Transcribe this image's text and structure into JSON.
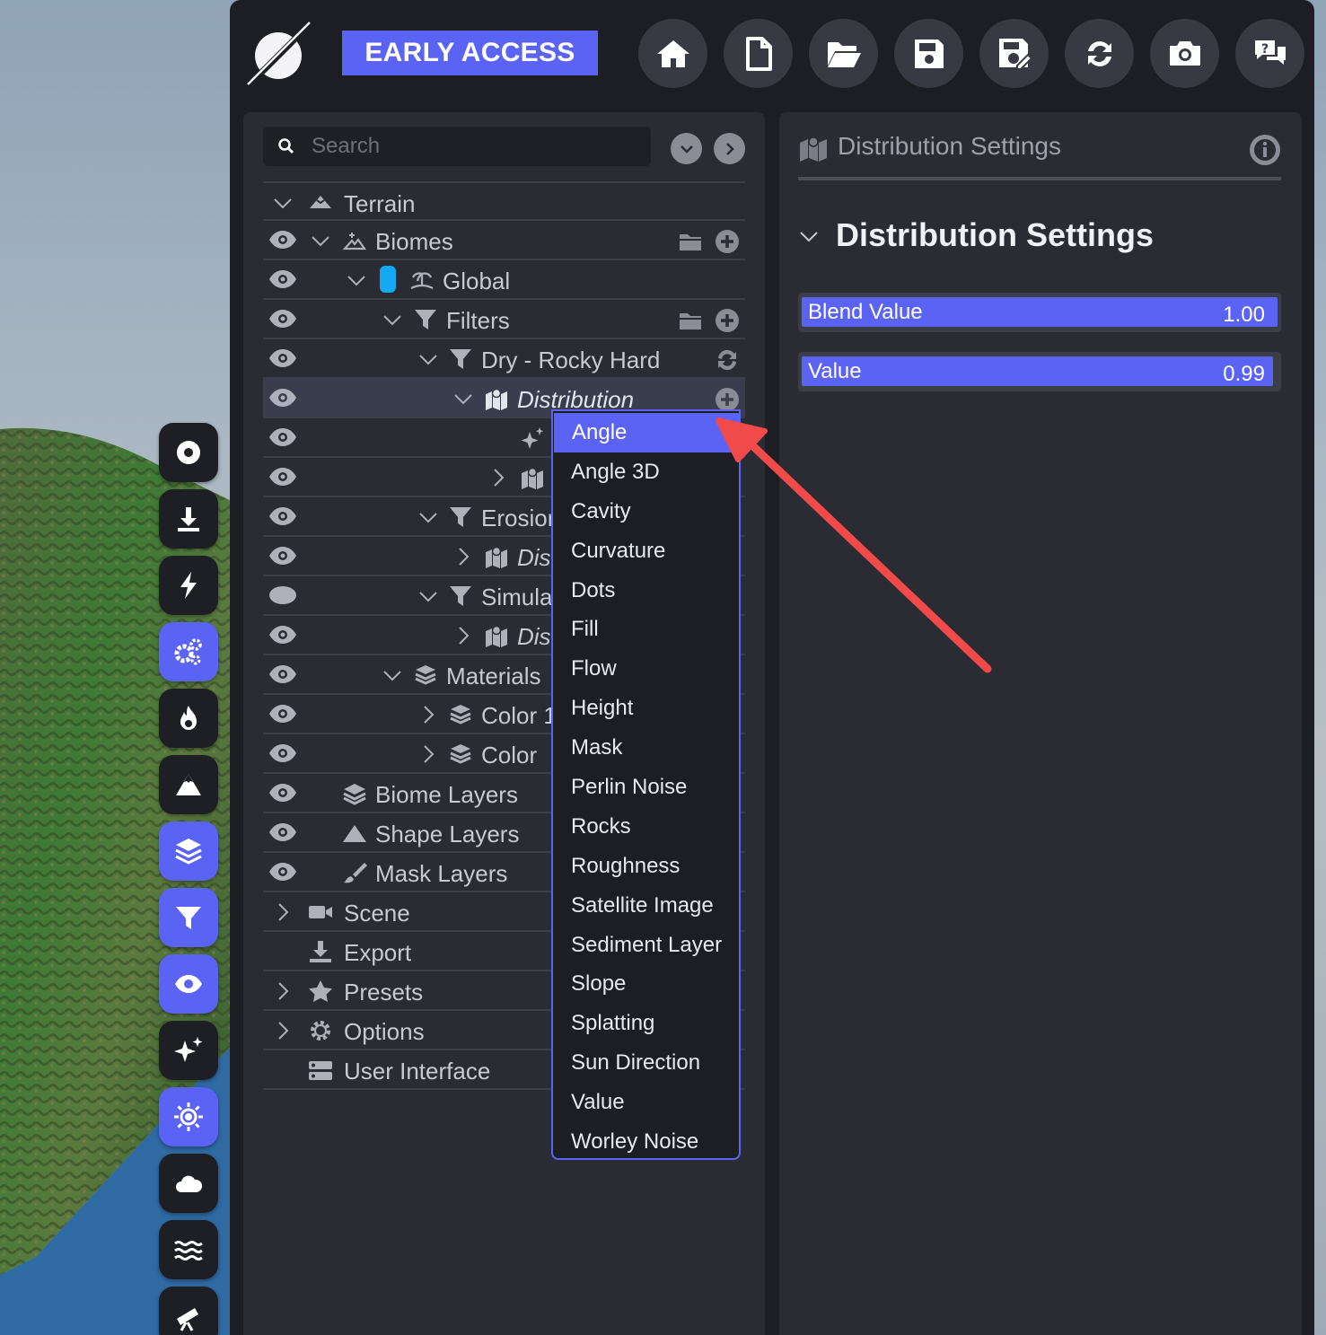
{
  "app": {
    "badge": "EARLY ACCESS",
    "toolbar": [
      {
        "icon": "home-icon"
      },
      {
        "icon": "new-file-icon"
      },
      {
        "icon": "open-folder-icon"
      },
      {
        "icon": "save-icon"
      },
      {
        "icon": "save-as-icon"
      },
      {
        "icon": "refresh-icon"
      },
      {
        "icon": "camera-icon"
      },
      {
        "icon": "help-chat-icon"
      }
    ],
    "accent_color": "#5b63f5"
  },
  "side_tools": [
    {
      "icon": "circle-target-icon",
      "active": false
    },
    {
      "icon": "download-icon",
      "active": false
    },
    {
      "icon": "lightning-icon",
      "active": false
    },
    {
      "icon": "gears-icon",
      "active": true
    },
    {
      "icon": "fire-icon",
      "active": false
    },
    {
      "icon": "mountain-icon",
      "active": false
    },
    {
      "icon": "layers-icon",
      "active": true
    },
    {
      "icon": "filter-icon",
      "active": true
    },
    {
      "icon": "eye-icon",
      "active": true
    },
    {
      "icon": "sparkles-icon",
      "active": false
    },
    {
      "icon": "sun-icon",
      "active": true
    },
    {
      "icon": "cloud-icon",
      "active": false
    },
    {
      "icon": "water-icon",
      "active": false
    },
    {
      "icon": "telescope-icon",
      "active": false
    }
  ],
  "tree": {
    "search_placeholder": "Search",
    "rows": {
      "terrain": "Terrain",
      "biomes": "Biomes",
      "global": "Global",
      "filters": "Filters",
      "dry_rocky": "Dry - Rocky Hard",
      "distribution": "Distribution",
      "erosion": "Erosior",
      "erosion_dist": "Dist",
      "simulation": "Simula",
      "simulation_dist": "Dist",
      "materials": "Materials",
      "color1": "Color 1",
      "color2": "Color",
      "biome_layers": "Biome Layers",
      "shape_layers": "Shape Layers",
      "mask_layers": "Mask Layers",
      "scene": "Scene",
      "export": "Export",
      "presets": "Presets",
      "options": "Options",
      "user_interface": "User Interface"
    }
  },
  "dropdown": {
    "items": [
      "Angle",
      "Angle 3D",
      "Cavity",
      "Curvature",
      "Dots",
      "Fill",
      "Flow",
      "Height",
      "Mask",
      "Perlin Noise",
      "Rocks",
      "Roughness",
      "Satellite Image",
      "Sediment Layer",
      "Slope",
      "Splatting",
      "Sun Direction",
      "Value",
      "Worley Noise"
    ],
    "highlighted": "Angle"
  },
  "settings": {
    "header": "Distribution Settings",
    "section": "Distribution Settings",
    "sliders": [
      {
        "name": "Blend Value",
        "value": "1.00",
        "fraction": 1.0
      },
      {
        "name": "Value",
        "value": "0.99",
        "fraction": 0.99
      }
    ]
  }
}
